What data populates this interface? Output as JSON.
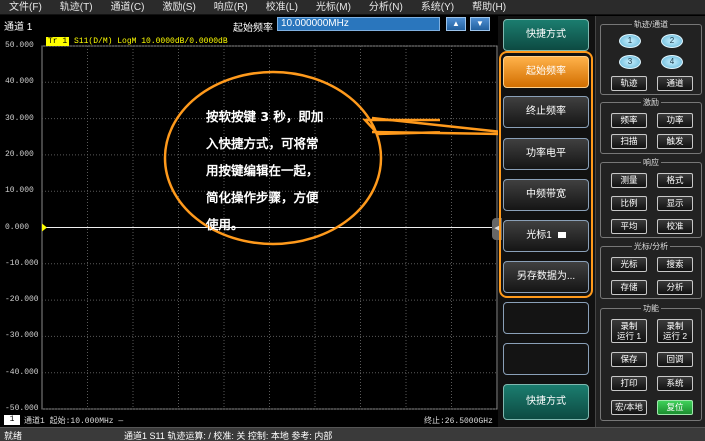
{
  "menu": [
    "文件(F)",
    "轨迹(T)",
    "通道(C)",
    "激励(S)",
    "响应(R)",
    "校准(L)",
    "光标(M)",
    "分析(N)",
    "系统(Y)",
    "帮助(H)"
  ],
  "channel_title": "通道 1",
  "start_freq": {
    "label": "起始频率",
    "value": "10.000000MHz",
    "up_icon": "arrow-up-icon",
    "down_icon": "arrow-down-icon"
  },
  "trace": {
    "tag": "Tr 1",
    "info": "S11(D/M) LogM 10.0000dB/0.0000dB"
  },
  "chart_data": {
    "type": "line",
    "yticks": [
      "50.000",
      "40.000",
      "30.000",
      "20.000",
      "10.000",
      "0.000",
      "-10.000",
      "-20.000",
      "-30.000",
      "-40.000",
      "-50.000"
    ],
    "ylim": [
      -50,
      50
    ],
    "series": [
      {
        "values": [
          0,
          0
        ]
      }
    ],
    "reference_level": 0,
    "grid": true,
    "colors": {
      "trace": "#ffff00",
      "grid": "#5a5a5a",
      "reference_marker": "#ffff00"
    }
  },
  "plot_footer": {
    "badge": "1",
    "left": "通道1  起始:10.000MHz —",
    "right": "终止:26.5000GHz"
  },
  "status_bar": {
    "state": "就绪",
    "info": "通道1  S11  轨迹运算: /  校准: 关  控制: 本地  参考: 内部"
  },
  "softkeys": {
    "header": "快捷方式",
    "items": [
      "起始频率",
      "终止频率",
      "功率电平",
      "中频带宽",
      "光标1",
      "另存数据为..."
    ],
    "footer": "快捷方式"
  },
  "callout": {
    "lines": [
      "按软按键 3 秒，即加",
      "入快捷方式，可将常",
      "用按键编辑在一起，",
      "简化操作步骤，方便",
      "使用。"
    ],
    "border_color": "#ff9a1c"
  },
  "hard_panel": {
    "trace_channel": {
      "title": "轨迹/通道",
      "circles": [
        "1",
        "2",
        "3",
        "4"
      ],
      "buttons": [
        "轨迹",
        "通道"
      ]
    },
    "stimulus": {
      "title": "激励",
      "buttons": [
        "频率",
        "功率",
        "扫描",
        "触发"
      ]
    },
    "response": {
      "title": "响应",
      "buttons": [
        "测量",
        "格式",
        "比例",
        "显示",
        "平均",
        "校准"
      ]
    },
    "marker_analysis": {
      "title": "光标/分析",
      "buttons": [
        "光标",
        "搜索",
        "存储",
        "分析"
      ]
    },
    "function": {
      "title": "功能",
      "buttons": [
        "录制\n运行 1",
        "录制\n运行 2",
        "保存",
        "回调",
        "打印",
        "系统",
        "宏/本地",
        "复位"
      ]
    }
  }
}
